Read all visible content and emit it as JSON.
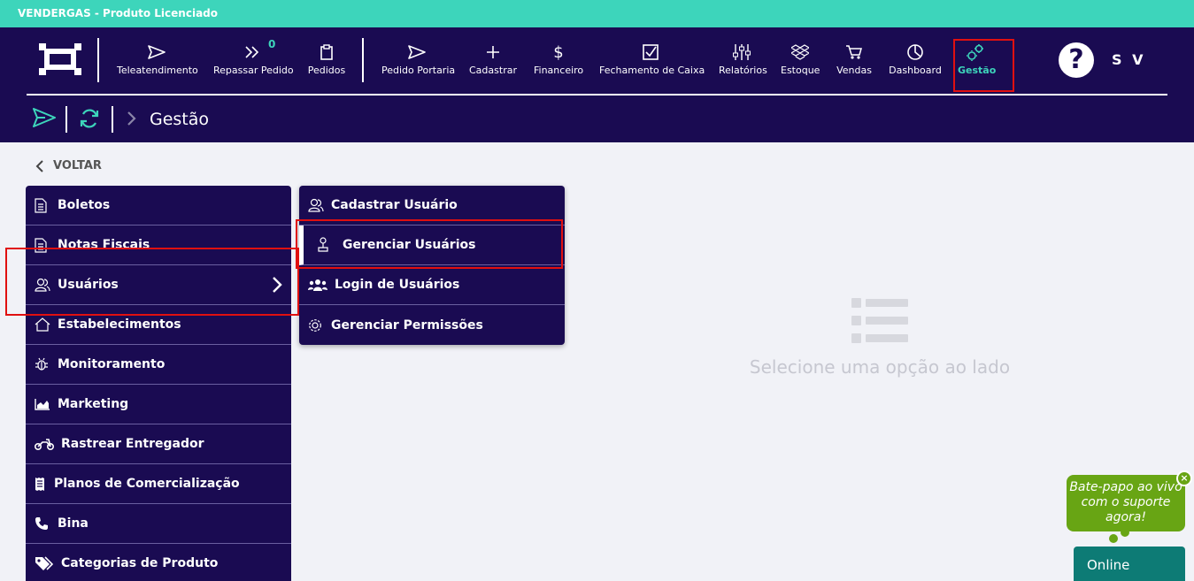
{
  "topbar": {
    "title": "VENDERGAS - Produto Licenciado"
  },
  "nav": {
    "items": [
      {
        "label": "Teleatendimento",
        "icon": "send-icon"
      },
      {
        "label": "Repassar Pedido",
        "icon": "double-chevron-icon",
        "badge": "0"
      },
      {
        "label": "Pedidos",
        "icon": "clipboard-icon"
      },
      {
        "label": "Pedido Portaria",
        "icon": "send-icon"
      },
      {
        "label": "Cadastrar",
        "icon": "plus-icon"
      },
      {
        "label": "Financeiro",
        "icon": "dollar-icon"
      },
      {
        "label": "Fechamento de Caixa",
        "icon": "checkbox-icon"
      },
      {
        "label": "Relatórios",
        "icon": "sliders-icon"
      },
      {
        "label": "Estoque",
        "icon": "dropbox-icon"
      },
      {
        "label": "Vendas",
        "icon": "cart-icon"
      },
      {
        "label": "Dashboard",
        "icon": "pie-chart-icon"
      },
      {
        "label": "Gestão",
        "icon": "gears-icon"
      }
    ],
    "help": "?",
    "user": "S V"
  },
  "breadcrumb": {
    "title": "Gestão"
  },
  "back_label": "VOLTAR",
  "menu": {
    "items": [
      {
        "label": "Boletos",
        "icon": "document-icon"
      },
      {
        "label": "Notas Fiscais",
        "icon": "document-icon"
      },
      {
        "label": "Usuários",
        "icon": "users-icon"
      },
      {
        "label": "Estabelecimentos",
        "icon": "home-icon"
      },
      {
        "label": "Monitoramento",
        "icon": "bug-icon"
      },
      {
        "label": "Marketing",
        "icon": "area-chart-icon"
      },
      {
        "label": "Rastrear Entregador",
        "icon": "motorcycle-icon"
      },
      {
        "label": "Planos de Comercialização",
        "icon": "receipt-icon"
      },
      {
        "label": "Bina",
        "icon": "phone-icon"
      },
      {
        "label": "Categorias de Produto",
        "icon": "tags-icon"
      }
    ]
  },
  "submenu": {
    "items": [
      {
        "label": "Cadastrar Usuário",
        "icon": "users-icon"
      },
      {
        "label": "Gerenciar Usuários",
        "icon": "joystick-icon"
      },
      {
        "label": "Login de Usuários",
        "icon": "group-icon"
      },
      {
        "label": "Gerenciar Permissões",
        "icon": "gear-icon"
      }
    ]
  },
  "empty_state": {
    "text": "Selecione uma opção ao lado"
  },
  "chat": {
    "bubble": "Bate-papo ao vivo com o suporte agora!",
    "close": "×",
    "status": "Online"
  },
  "colors": {
    "navy": "#1a0b52",
    "teal": "#3dd5bb",
    "chat_green": "#68a514",
    "chat_teal": "#0d7b75",
    "highlight": "#e01010"
  }
}
